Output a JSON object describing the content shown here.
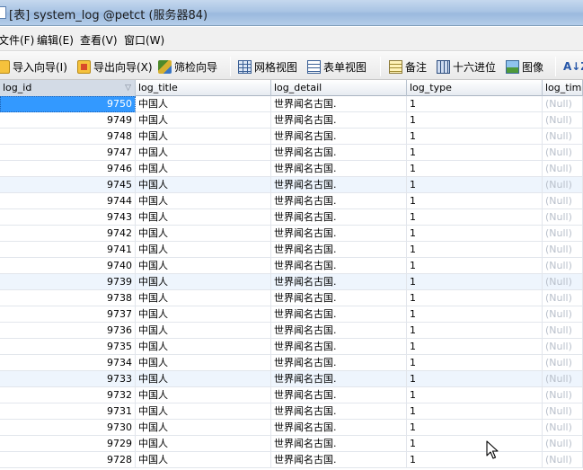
{
  "window": {
    "title": "[表] system_log @petct (服务器84)"
  },
  "menu": [
    {
      "label": "文件(F)"
    },
    {
      "label": "编辑(E)"
    },
    {
      "label": "查看(V)"
    },
    {
      "label": "窗口(W)"
    }
  ],
  "toolbar": {
    "import_label": "导入向导(I)",
    "export_label": "导出向导(X)",
    "filter_label": "筛检向导",
    "grid_view_label": "网格视图",
    "form_view_label": "表单视图",
    "note_label": "备注",
    "hex_label": "十六进位",
    "image_label": "图像",
    "sort_glyph": "A↓Z"
  },
  "icons": {
    "import": "import-icon",
    "export": "export-icon",
    "filter": "filter-wizard-icon",
    "grid_view": "grid-view-icon",
    "form_view": "form-view-icon",
    "note": "memo-icon",
    "hex": "hex-icon",
    "image": "image-icon",
    "sort": "sort-icon",
    "cursor": "mouse-pointer-icon"
  },
  "colors": {
    "selection": "#3399ff",
    "alt_row": "#eef5fd",
    "null_text": "#b9c0cb"
  },
  "table": {
    "columns": [
      "log_id",
      "log_title",
      "log_detail",
      "log_type",
      "log_time"
    ],
    "sort_arrow": "▽",
    "selected_log_id": "9750",
    "rows": [
      {
        "log_id": "9750",
        "log_title": "中国人",
        "log_detail": "世界闻名古国.",
        "log_type": "1",
        "log_time": "(Null)"
      },
      {
        "log_id": "9749",
        "log_title": "中国人",
        "log_detail": "世界闻名古国.",
        "log_type": "1",
        "log_time": "(Null)"
      },
      {
        "log_id": "9748",
        "log_title": "中国人",
        "log_detail": "世界闻名古国.",
        "log_type": "1",
        "log_time": "(Null)"
      },
      {
        "log_id": "9747",
        "log_title": "中国人",
        "log_detail": "世界闻名古国.",
        "log_type": "1",
        "log_time": "(Null)"
      },
      {
        "log_id": "9746",
        "log_title": "中国人",
        "log_detail": "世界闻名古国.",
        "log_type": "1",
        "log_time": "(Null)"
      },
      {
        "log_id": "9745",
        "log_title": "中国人",
        "log_detail": "世界闻名古国.",
        "log_type": "1",
        "log_time": "(Null)"
      },
      {
        "log_id": "9744",
        "log_title": "中国人",
        "log_detail": "世界闻名古国.",
        "log_type": "1",
        "log_time": "(Null)"
      },
      {
        "log_id": "9743",
        "log_title": "中国人",
        "log_detail": "世界闻名古国.",
        "log_type": "1",
        "log_time": "(Null)"
      },
      {
        "log_id": "9742",
        "log_title": "中国人",
        "log_detail": "世界闻名古国.",
        "log_type": "1",
        "log_time": "(Null)"
      },
      {
        "log_id": "9741",
        "log_title": "中国人",
        "log_detail": "世界闻名古国.",
        "log_type": "1",
        "log_time": "(Null)"
      },
      {
        "log_id": "9740",
        "log_title": "中国人",
        "log_detail": "世界闻名古国.",
        "log_type": "1",
        "log_time": "(Null)"
      },
      {
        "log_id": "9739",
        "log_title": "中国人",
        "log_detail": "世界闻名古国.",
        "log_type": "1",
        "log_time": "(Null)"
      },
      {
        "log_id": "9738",
        "log_title": "中国人",
        "log_detail": "世界闻名古国.",
        "log_type": "1",
        "log_time": "(Null)"
      },
      {
        "log_id": "9737",
        "log_title": "中国人",
        "log_detail": "世界闻名古国.",
        "log_type": "1",
        "log_time": "(Null)"
      },
      {
        "log_id": "9736",
        "log_title": "中国人",
        "log_detail": "世界闻名古国.",
        "log_type": "1",
        "log_time": "(Null)"
      },
      {
        "log_id": "9735",
        "log_title": "中国人",
        "log_detail": "世界闻名古国.",
        "log_type": "1",
        "log_time": "(Null)"
      },
      {
        "log_id": "9734",
        "log_title": "中国人",
        "log_detail": "世界闻名古国.",
        "log_type": "1",
        "log_time": "(Null)"
      },
      {
        "log_id": "9733",
        "log_title": "中国人",
        "log_detail": "世界闻名古国.",
        "log_type": "1",
        "log_time": "(Null)"
      },
      {
        "log_id": "9732",
        "log_title": "中国人",
        "log_detail": "世界闻名古国.",
        "log_type": "1",
        "log_time": "(Null)"
      },
      {
        "log_id": "9731",
        "log_title": "中国人",
        "log_detail": "世界闻名古国.",
        "log_type": "1",
        "log_time": "(Null)"
      },
      {
        "log_id": "9730",
        "log_title": "中国人",
        "log_detail": "世界闻名古国.",
        "log_type": "1",
        "log_time": "(Null)"
      },
      {
        "log_id": "9729",
        "log_title": "中国人",
        "log_detail": "世界闻名古国.",
        "log_type": "1",
        "log_time": "(Null)"
      },
      {
        "log_id": "9728",
        "log_title": "中国人",
        "log_detail": "世界闻名古国.",
        "log_type": "1",
        "log_time": "(Null)"
      }
    ]
  }
}
